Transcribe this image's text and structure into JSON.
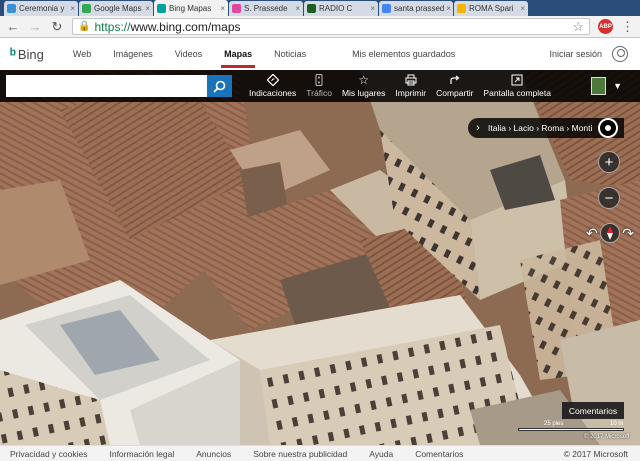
{
  "browser": {
    "tabs": [
      {
        "label": "Ceremonia y",
        "color": "#3b8fd6",
        "active": false
      },
      {
        "label": "Google Maps",
        "color": "#34a853",
        "active": false
      },
      {
        "label": "Bing Mapas",
        "color": "#00a19c",
        "active": true
      },
      {
        "label": "S. Prassede",
        "color": "#e0479e",
        "active": false
      },
      {
        "label": "RADIO C",
        "color": "#1b5e20",
        "active": false
      },
      {
        "label": "santa prassed",
        "color": "#4285f4",
        "active": false
      },
      {
        "label": "ROMA Spari",
        "color": "#f4b400",
        "active": false
      }
    ],
    "url_scheme": "https://",
    "url_rest": "www.bing.com/maps",
    "abp_label": "ABP"
  },
  "header": {
    "logo_text": "Bing",
    "nav": [
      "Web",
      "Imágenes",
      "Videos",
      "Mapas",
      "Noticias"
    ],
    "active_nav": "Mapas",
    "saved_label": "Mis elementos guardados",
    "signin_label": "Iniciar sesión"
  },
  "toolbar": {
    "search_placeholder": "",
    "tools": [
      {
        "label": "Indicaciones",
        "icon": "directions-icon",
        "dim": false
      },
      {
        "label": "Tráfico",
        "icon": "traffic-icon",
        "dim": true
      },
      {
        "label": "Mis lugares",
        "icon": "star-icon",
        "dim": false
      },
      {
        "label": "Imprimir",
        "icon": "print-icon",
        "dim": false
      },
      {
        "label": "Compartir",
        "icon": "share-icon",
        "dim": false
      },
      {
        "label": "Pantalla completa",
        "icon": "fullscreen-icon",
        "dim": false
      }
    ]
  },
  "map": {
    "breadcrumb": "Italia › Lacio › Roma › Monti",
    "feedback_label": "Comentarios",
    "scale_left": "25 pies",
    "scale_right": "10 m",
    "copyright": "© 2017 Microsoft"
  },
  "footer": {
    "links": [
      "Privacidad y cookies",
      "Información legal",
      "Anuncios",
      "Sobre nuestra publicidad",
      "Ayuda",
      "Comentarios"
    ],
    "copyright": "© 2017 Microsoft"
  }
}
